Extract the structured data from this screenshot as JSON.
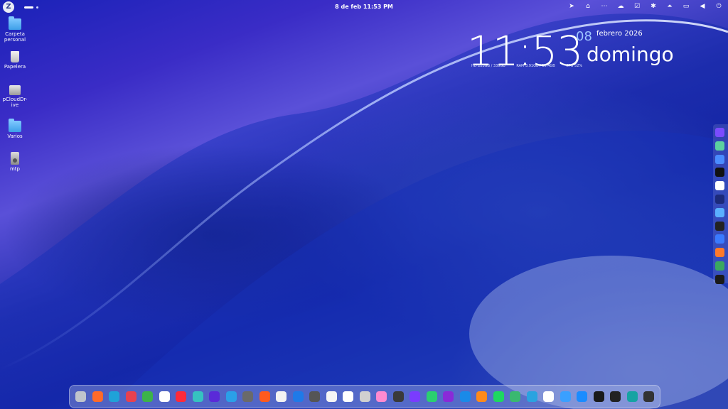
{
  "topbar": {
    "logo": "Z",
    "datetime": "8 de feb  11:53 PM",
    "tray_icons": [
      "telegram-icon",
      "network-icon",
      "more-icon",
      "cloud-icon",
      "clipboard-icon",
      "bluetooth-icon",
      "upload-icon",
      "display-icon",
      "volume-icon",
      "power-icon"
    ]
  },
  "desktop": {
    "items": [
      {
        "label": "Carpeta personal",
        "icon": "home-folder-icon"
      },
      {
        "label": "Papelera",
        "icon": "trash-icon"
      },
      {
        "label": "pCloudDr-ive",
        "icon": "drive-icon"
      },
      {
        "label": "Varios",
        "icon": "folder-icon"
      },
      {
        "label": "mtp",
        "icon": "media-player-icon"
      }
    ]
  },
  "clock": {
    "time": "11:53",
    "day": "08",
    "month_year": "febrero 2026",
    "weekday": "domingo",
    "hd": "HD  223GB / 339GB",
    "ram": "RAM  3.91GB / 15.4GB",
    "cpu": "CPU  52%"
  },
  "sidebar_icons": [
    {
      "name": "ai-app-icon",
      "color": "#7a4cff"
    },
    {
      "name": "copilot-icon",
      "color": "#5bd0a0"
    },
    {
      "name": "gemini-icon",
      "color": "#4a8cff"
    },
    {
      "name": "grok-icon",
      "color": "#111111"
    },
    {
      "name": "flask-icon",
      "color": "#ffffff"
    },
    {
      "name": "chatgpt-icon",
      "color": "#1c2a7a"
    },
    {
      "name": "diamond-icon",
      "color": "#5ab0ff"
    },
    {
      "name": "c-app-icon",
      "color": "#222222"
    },
    {
      "name": "perplexity-icon",
      "color": "#3a7bff"
    },
    {
      "name": "orange-app-icon",
      "color": "#ff7a2a"
    },
    {
      "name": "leaf-app-icon",
      "color": "#3aa860"
    },
    {
      "name": "terminal-app-icon",
      "color": "#1a1a1a"
    }
  ],
  "dock_icons": [
    {
      "name": "settings-icon",
      "color": "#bfc4cc"
    },
    {
      "name": "firefox-icon",
      "color": "#ff6a2a"
    },
    {
      "name": "edge-icon",
      "color": "#1fa2d8"
    },
    {
      "name": "vivaldi-icon",
      "color": "#e8414f"
    },
    {
      "name": "chrome-icon",
      "color": "#3cb34a"
    },
    {
      "name": "yandex-icon",
      "color": "#ffffff"
    },
    {
      "name": "opera-icon",
      "color": "#ff2a3a"
    },
    {
      "name": "floorp-icon",
      "color": "#36c3c0"
    },
    {
      "name": "f-app-icon",
      "color": "#5a2ad8"
    },
    {
      "name": "cloud-app-icon",
      "color": "#2aa0e8"
    },
    {
      "name": "tor-icon",
      "color": "#6a6a6a"
    },
    {
      "name": "brave-icon",
      "color": "#ff5a1f"
    },
    {
      "name": "notes-app-icon",
      "color": "#f2f2f2"
    },
    {
      "name": "blue-app-icon",
      "color": "#1f7ae8"
    },
    {
      "name": "calculator-icon",
      "color": "#555555"
    },
    {
      "name": "document-app-icon",
      "color": "#f5f5f5"
    },
    {
      "name": "paint-app-icon",
      "color": "#ffffff"
    },
    {
      "name": "gear-app-icon",
      "color": "#d0d0d0"
    },
    {
      "name": "palette-app-icon",
      "color": "#ff8ad0"
    },
    {
      "name": "brush-icon",
      "color": "#3a3a3a"
    },
    {
      "name": "media-app-icon",
      "color": "#7a3cff"
    },
    {
      "name": "play-store-icon",
      "color": "#2ad070"
    },
    {
      "name": "link-app-icon",
      "color": "#8a2ad8"
    },
    {
      "name": "video-player-icon",
      "color": "#1a8ae8"
    },
    {
      "name": "orange-media-icon",
      "color": "#ff8a1a"
    },
    {
      "name": "spotify-icon",
      "color": "#1ed760"
    },
    {
      "name": "green-app-icon",
      "color": "#3ab870"
    },
    {
      "name": "telegram-app-icon",
      "color": "#2aa3e0"
    },
    {
      "name": "whatsapp-icon",
      "color": "#ffffff"
    },
    {
      "name": "finder-icon",
      "color": "#3aa0ff"
    },
    {
      "name": "app-store-icon",
      "color": "#1a8cff"
    },
    {
      "name": "terminal-icon",
      "color": "#1a1a1a"
    },
    {
      "name": "system-monitor-icon",
      "color": "#222222"
    },
    {
      "name": "teal-app-icon",
      "color": "#16a3a3"
    },
    {
      "name": "clock-app-icon",
      "color": "#333333"
    }
  ]
}
